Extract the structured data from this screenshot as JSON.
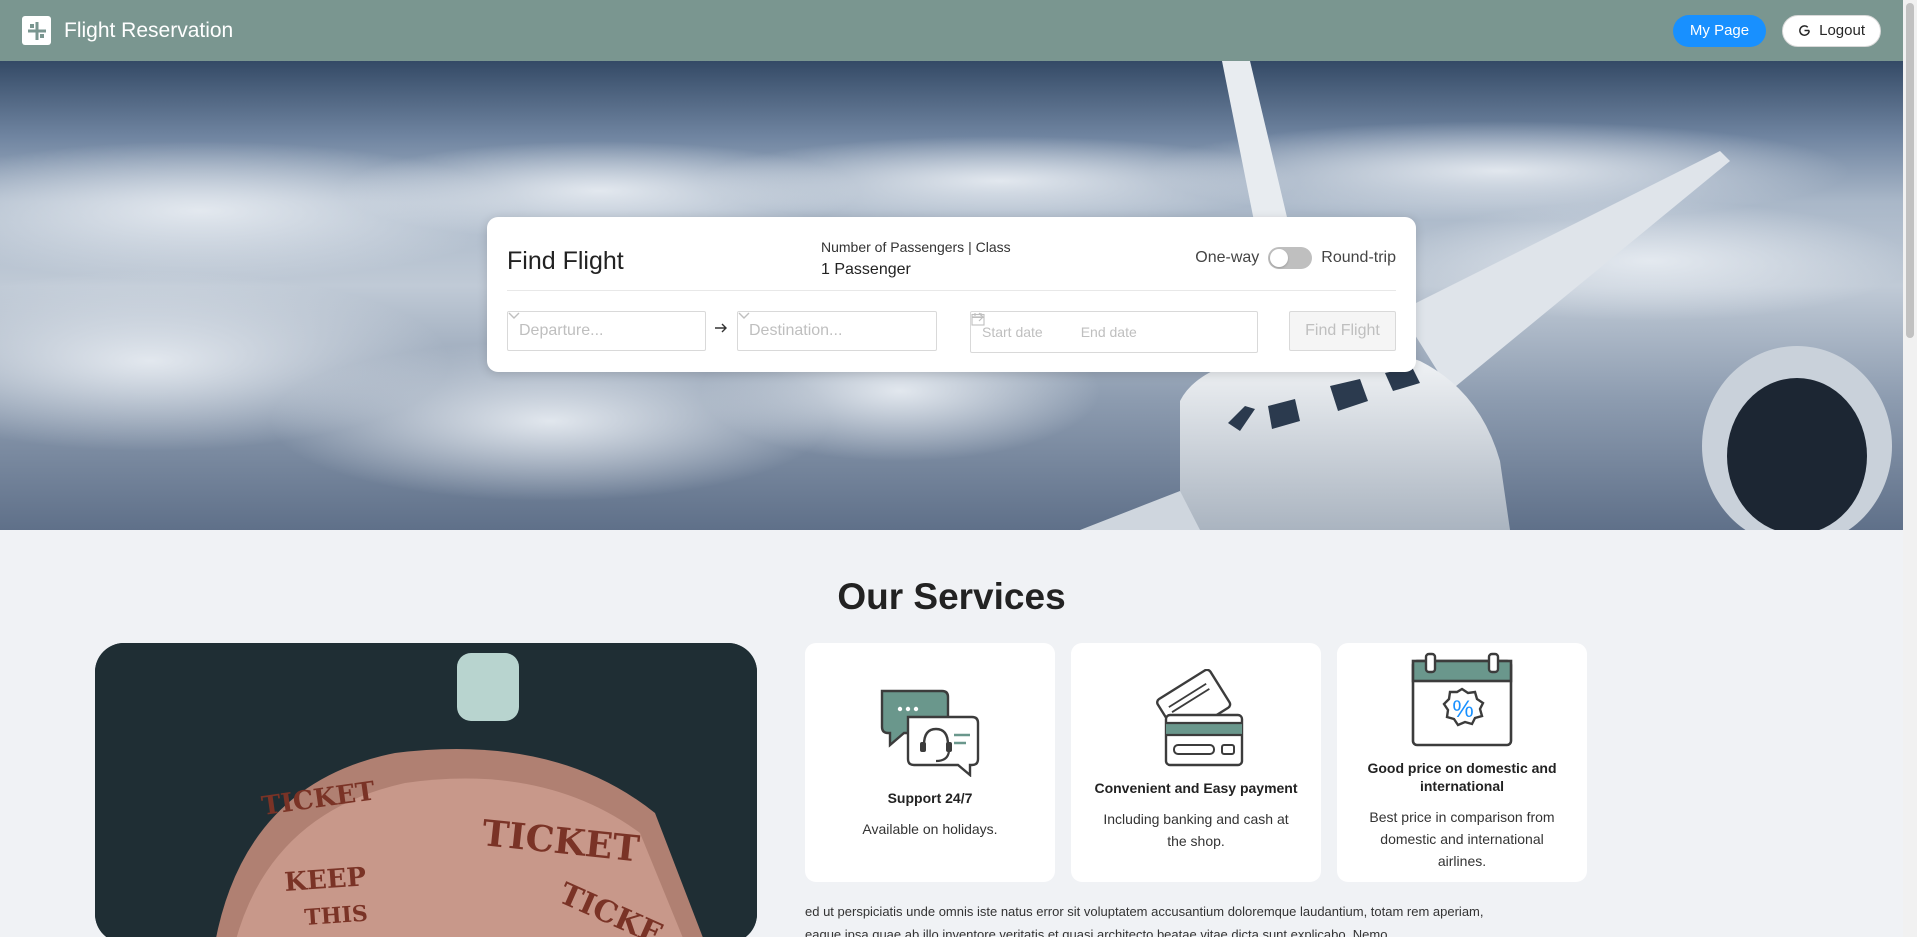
{
  "app": {
    "title": "Flight Reservation"
  },
  "header": {
    "my_page": "My Page",
    "logout": "Logout"
  },
  "find": {
    "title": "Find Flight",
    "passengers_label": "Number of Passengers | Class",
    "passengers_value": "1 Passenger",
    "one_way": "One-way",
    "round_trip": "Round-trip",
    "departure_placeholder": "Departure...",
    "destination_placeholder": "Destination...",
    "start_date": "Start date",
    "end_date": "End date",
    "find_button": "Find Flight"
  },
  "services": {
    "title": "Our Services",
    "cards": [
      {
        "title": "Support 24/7",
        "desc": "Available on holidays."
      },
      {
        "title": "Convenient and Easy payment",
        "desc": "Including banking and cash at the shop."
      },
      {
        "title": "Good price on domestic and international",
        "desc": "Best price in comparison from domestic and international airlines."
      }
    ],
    "ticket_text": [
      "TICKET",
      "TICKET",
      "KEEP",
      "THIS",
      "TICKE"
    ],
    "body": "ed ut perspiciatis unde omnis iste natus error sit voluptatem accusantium doloremque laudantium, totam rem aperiam, eaque ipsa quae ab illo inventore veritatis et quasi architecto beatae vitae dicta sunt explicabo. Nemo"
  },
  "colors": {
    "header": "#7a9690",
    "primary": "#1890ff",
    "accent": "#6a978c",
    "icon_line": "#3c3c3c"
  }
}
